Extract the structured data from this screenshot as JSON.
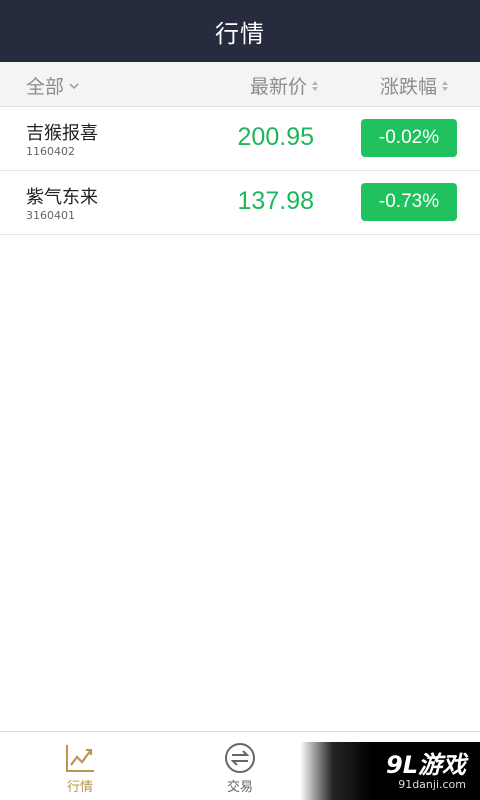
{
  "header": {
    "title": "行情"
  },
  "columns": {
    "all": "全部",
    "price": "最新价",
    "change": "涨跌幅"
  },
  "rows": [
    {
      "name": "吉猴报喜",
      "code": "1160402",
      "price": "200.95",
      "change": "-0.02%"
    },
    {
      "name": "紫气东来",
      "code": "3160401",
      "price": "137.98",
      "change": "-0.73%"
    }
  ],
  "tabs": [
    {
      "label": "行情",
      "icon": "chart-line-icon",
      "active": true
    },
    {
      "label": "交易",
      "icon": "exchange-arrows-icon",
      "active": false
    },
    {
      "label": "",
      "icon": "circle-icon",
      "active": false
    }
  ],
  "watermark": {
    "logo": "9L游戏",
    "url": "91danji.com"
  },
  "colors": {
    "header_bg": "#262b3d",
    "price_green": "#1fb65b",
    "badge_green": "#20c15f",
    "active_tab": "#b9954d"
  }
}
